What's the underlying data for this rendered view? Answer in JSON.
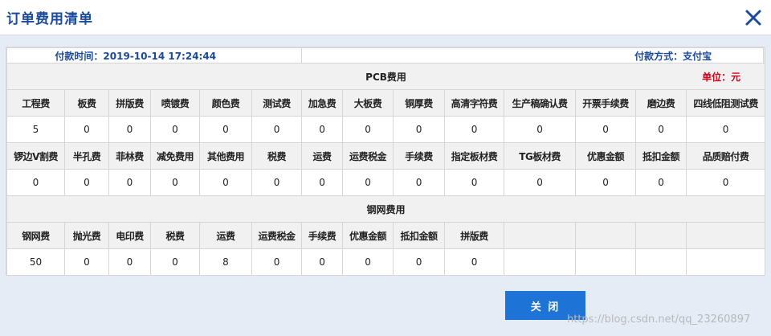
{
  "dialog": {
    "title": "订单费用清单",
    "close_icon": "close-icon"
  },
  "payment": {
    "time_label": "付款时间：",
    "time_value": "2019-10-14 17:24:44",
    "method_label": "付款方式：",
    "method_value": "支付宝"
  },
  "pcb": {
    "section_title": "PCB费用",
    "unit": "单位：元",
    "row1_headers": [
      "工程费",
      "板费",
      "拼版费",
      "喷镀费",
      "颜色费",
      "测试费",
      "加急费",
      "大板费",
      "铜厚费",
      "高清字符费",
      "生产稿确认费",
      "开票手续费",
      "磨边费",
      "四线低阻测试费"
    ],
    "row1_values": [
      "5",
      "0",
      "0",
      "0",
      "0",
      "0",
      "0",
      "0",
      "0",
      "0",
      "0",
      "0",
      "0",
      "0"
    ],
    "row2_headers": [
      "锣边V割费",
      "半孔费",
      "菲林费",
      "减免费用",
      "其他费用",
      "税费",
      "运费",
      "运费税金",
      "手续费",
      "指定板材费",
      "TG板材费",
      "优惠金额",
      "抵扣金额",
      "品质赔付费"
    ],
    "row2_values": [
      "0",
      "0",
      "0",
      "0",
      "0",
      "0",
      "0",
      "0",
      "0",
      "0",
      "0",
      "0",
      "0",
      "0"
    ]
  },
  "stencil": {
    "section_title": "钢网费用",
    "headers": [
      "钢网费",
      "抛光费",
      "电印费",
      "税费",
      "运费",
      "运费税金",
      "手续费",
      "优惠金额",
      "抵扣金额",
      "拼版费",
      "",
      "",
      "",
      ""
    ],
    "values": [
      "50",
      "0",
      "0",
      "0",
      "8",
      "0",
      "0",
      "0",
      "0",
      "0",
      "",
      "",
      "",
      ""
    ]
  },
  "footer": {
    "close_button": "关 闭",
    "watermark": "https://blog.csdn.net/qq_23260897"
  },
  "colors": {
    "title": "#1a4a9e",
    "accent_button": "#1e73d6",
    "unit_red": "#d0021b",
    "background": "#e6ecf5"
  }
}
